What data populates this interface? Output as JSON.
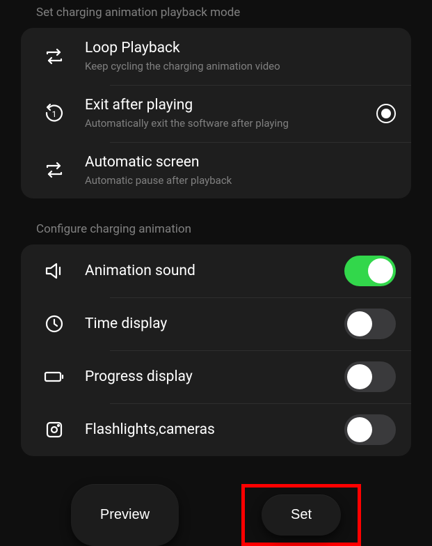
{
  "sections": {
    "playback": {
      "header": "Set charging animation playback mode",
      "options": [
        {
          "title": "Loop Playback",
          "subtitle": "Keep cycling the charging animation video",
          "selected": false
        },
        {
          "title": "Exit after playing",
          "subtitle": "Automatically exit the software after playing",
          "selected": true
        },
        {
          "title": "Automatic screen",
          "subtitle": "Automatic pause after playback",
          "selected": false
        }
      ]
    },
    "config": {
      "header": "Configure charging animation",
      "toggles": [
        {
          "title": "Animation sound",
          "on": true
        },
        {
          "title": "Time display",
          "on": false
        },
        {
          "title": "Progress display",
          "on": false
        },
        {
          "title": "Flashlights,cameras",
          "on": false
        }
      ]
    }
  },
  "buttons": {
    "preview": "Preview",
    "set": "Set"
  }
}
